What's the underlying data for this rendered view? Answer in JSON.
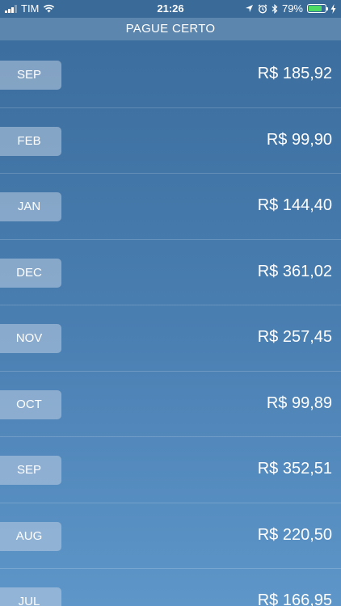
{
  "status_bar": {
    "carrier": "TIM",
    "time": "21:26",
    "battery_percent": "79%",
    "battery_level": 0.79,
    "icons": [
      "signal-icon",
      "wifi-icon",
      "location-icon",
      "alarm-icon",
      "bluetooth-icon",
      "battery-icon",
      "charging-icon"
    ]
  },
  "nav": {
    "title": "PAGUE CERTO"
  },
  "colors": {
    "background_top": "#3a6c9c",
    "background_bottom": "#5e96c9",
    "button_fill": "#becde1",
    "battery_green": "#4cd964"
  },
  "rows": [
    {
      "month": "SEP",
      "amount": "R$ 185,92"
    },
    {
      "month": "FEB",
      "amount": "R$ 99,90"
    },
    {
      "month": "JAN",
      "amount": "R$ 144,40"
    },
    {
      "month": "DEC",
      "amount": "R$ 361,02"
    },
    {
      "month": "NOV",
      "amount": "R$ 257,45"
    },
    {
      "month": "OCT",
      "amount": "R$ 99,89"
    },
    {
      "month": "SEP",
      "amount": "R$ 352,51"
    },
    {
      "month": "AUG",
      "amount": "R$ 220,50"
    },
    {
      "month": "JUL",
      "amount": "R$ 166,95"
    }
  ]
}
